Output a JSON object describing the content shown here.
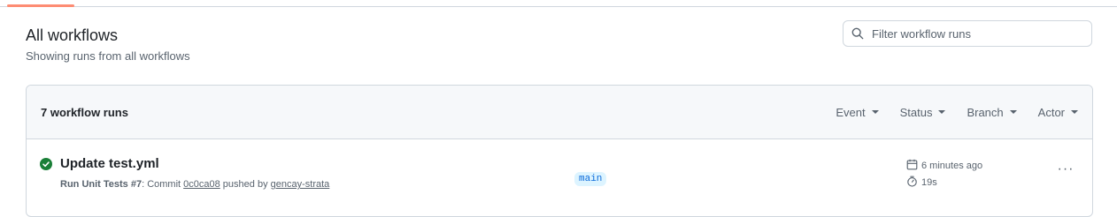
{
  "header": {
    "title": "All workflows",
    "subtitle": "Showing runs from all workflows"
  },
  "search": {
    "placeholder": "Filter workflow runs",
    "value": ""
  },
  "list_header": {
    "count_label": "7 workflow runs",
    "filters": [
      {
        "label": "Event"
      },
      {
        "label": "Status"
      },
      {
        "label": "Branch"
      },
      {
        "label": "Actor"
      }
    ]
  },
  "runs": [
    {
      "title": "Update test.yml",
      "status": "success",
      "workflow": "Run Unit Tests #7",
      "meta_mid": ": Commit ",
      "commit": "0c0ca08",
      "meta_pushed": " pushed by ",
      "actor": "gencay-strata",
      "branch": "main",
      "time": "6 minutes ago",
      "duration": "19s"
    }
  ],
  "colors": {
    "success": "#1a7f37",
    "branch_bg": "#ddf4ff",
    "branch_fg": "#0969da",
    "active_tab": "#fd8c73"
  },
  "icons": {
    "search": "search-icon",
    "status": "check-circle-icon",
    "calendar": "calendar-icon",
    "stopwatch": "stopwatch-icon",
    "more": "kebab-horizontal-icon"
  }
}
